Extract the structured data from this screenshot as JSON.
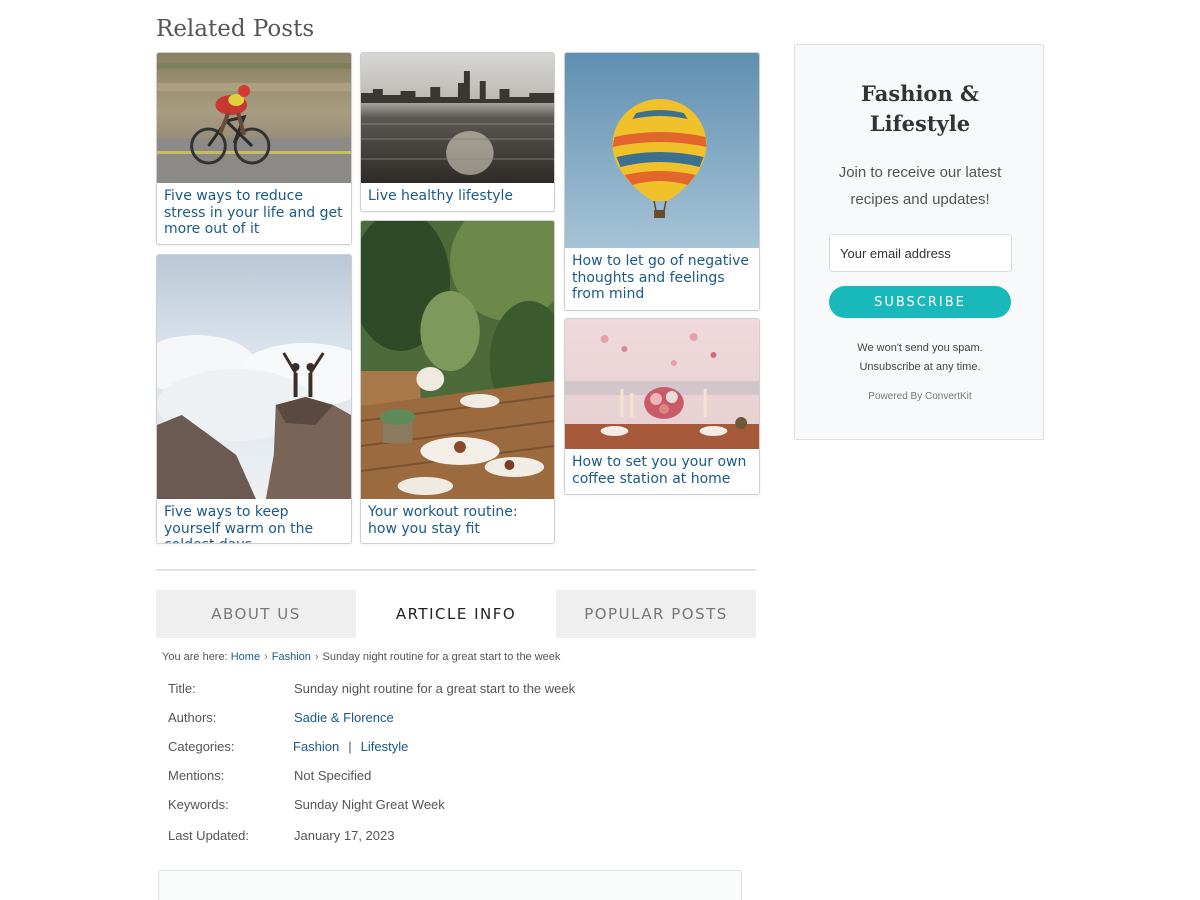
{
  "related": {
    "heading": "Related Posts",
    "posts": [
      {
        "title": "Five ways to reduce stress in your life and get more out of it",
        "image": "cyclist-photo"
      },
      {
        "title": "Live healthy lifestyle",
        "image": "city-skyline-water-photo"
      },
      {
        "title": "How to let go of negative thoughts and feelings from mind",
        "image": "hot-air-balloon-photo"
      },
      {
        "title": "Five ways to keep yourself warm on the coldest days",
        "image": "mountain-clouds-couple-photo"
      },
      {
        "title": "Your workout routine: how you stay fit",
        "image": "garden-table-dessert-photo"
      },
      {
        "title": "How to set you your own coffee station at home",
        "image": "floral-table-setting-photo"
      }
    ]
  },
  "tabs": [
    {
      "label": "ABOUT US",
      "active": false
    },
    {
      "label": "ARTICLE INFO",
      "active": true
    },
    {
      "label": "POPULAR POSTS",
      "active": false
    }
  ],
  "breadcrumb": {
    "prefix": "You are here:",
    "items": [
      "Home",
      "Fashion"
    ],
    "current": "Sunday night routine for a great start to the week",
    "separator": "›"
  },
  "article_info": {
    "title_label": "Title:",
    "title_value": "Sunday night routine for a great start to the week",
    "authors_label": "Authors:",
    "authors_value": "Sadie & Florence",
    "categories_label": "Categories:",
    "categories": [
      "Fashion",
      "Lifestyle"
    ],
    "category_separator": "|",
    "mentions_label": "Mentions:",
    "mentions_value": "Not Specified",
    "keywords_label": "Keywords:",
    "keywords_value": "Sunday Night Great Week",
    "updated_label": "Last Updated:",
    "updated_value": "January 17, 2023"
  },
  "sidebar": {
    "title": "Fashion &\nLifestyle",
    "description": "Join to receive our latest recipes and updates!",
    "email_placeholder": "Your email address",
    "subscribe_label": "SUBSCRIBE",
    "note": "We won't send you spam.\nUnsubscribe at any time.",
    "powered": "Powered By ConvertKit"
  },
  "colors": {
    "link": "#1a5a86",
    "accent": "#19b9bb",
    "tab_inactive_bg": "#efefef"
  }
}
